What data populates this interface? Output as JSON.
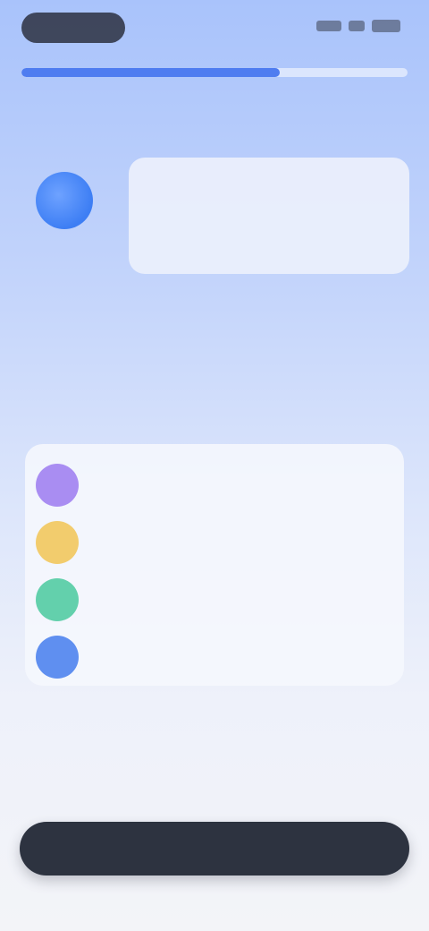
{
  "progress": {
    "value": 0.67
  },
  "status_bar": {
    "icons": [
      "signal-icon",
      "wifi-icon",
      "battery-icon"
    ]
  },
  "assistant": {
    "message": ""
  },
  "question": {
    "title": ""
  },
  "options": [
    {
      "label": "",
      "color": "#a98df2",
      "icon": "circle-icon"
    },
    {
      "label": "",
      "color": "#f2cc6d",
      "icon": "circle-icon"
    },
    {
      "label": "",
      "color": "#63d0ac",
      "icon": "circle-icon"
    },
    {
      "label": "",
      "color": "#5f8ff0",
      "icon": "circle-icon"
    }
  ],
  "footer": {
    "link_label": ""
  },
  "cta": {
    "label": ""
  },
  "colors": {
    "accent": "#4f7df0",
    "cta_background": "#2d3340"
  }
}
